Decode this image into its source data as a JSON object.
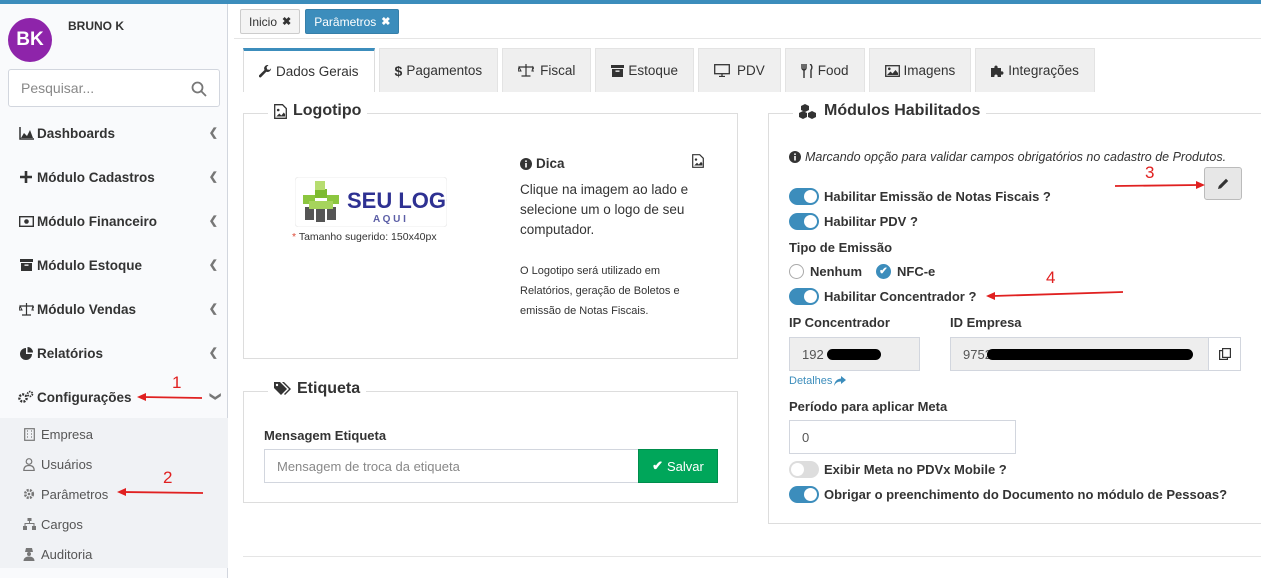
{
  "user": {
    "initials": "BK",
    "name": "BRUNO K"
  },
  "search": {
    "placeholder": "Pesquisar..."
  },
  "sidebar": {
    "items": [
      {
        "label": "Dashboards"
      },
      {
        "label": "Módulo Cadastros"
      },
      {
        "label": "Módulo Financeiro"
      },
      {
        "label": "Módulo Estoque"
      },
      {
        "label": "Módulo Vendas"
      },
      {
        "label": "Relatórios"
      },
      {
        "label": "Configurações"
      }
    ],
    "subitems": [
      {
        "label": "Empresa"
      },
      {
        "label": "Usuários"
      },
      {
        "label": "Parâmetros"
      },
      {
        "label": "Cargos"
      },
      {
        "label": "Auditoria"
      }
    ]
  },
  "breadcrumbs": [
    {
      "label": "Inicio"
    },
    {
      "label": "Parâmetros"
    }
  ],
  "tabs": [
    {
      "label": "Dados Gerais"
    },
    {
      "label": "Pagamentos"
    },
    {
      "label": "Fiscal"
    },
    {
      "label": "Estoque"
    },
    {
      "label": "PDV"
    },
    {
      "label": "Food"
    },
    {
      "label": "Imagens"
    },
    {
      "label": "Integrações"
    }
  ],
  "logotipo": {
    "title": "Logotipo",
    "logo_text_1": "SEU LOGO",
    "logo_text_2": "A Q U I",
    "size_star": "*",
    "size_hint": "Tamanho sugerido: 150x40px",
    "tip_title": "Dica",
    "tip_text": "Clique na imagem ao lado e selecione um o logo de seu computador.",
    "tip_note": "O Logotipo será utilizado em Relatórios, geração de Boletos e emissão de Notas Fiscais."
  },
  "etiqueta": {
    "title": "Etiqueta",
    "field_label": "Mensagem Etiqueta",
    "field_placeholder": "Mensagem de troca da etiqueta",
    "save_label": "Salvar"
  },
  "modulos": {
    "title": "Módulos Habilitados",
    "note": "Marcando opção para validar campos obrigatórios no cadastro de Produtos.",
    "toggle_nfe": "Habilitar Emissão de Notas Fiscais ?",
    "toggle_pdv": "Habilitar PDV ?",
    "emissao_label": "Tipo de Emissão",
    "radio_nenhum": "Nenhum",
    "radio_nfce": "NFC-e",
    "toggle_concentrador": "Habilitar Concentrador ?",
    "ip_label": "IP Concentrador",
    "ip_value": "192",
    "empresa_label": "ID Empresa",
    "empresa_value": "9752",
    "detalhes": "Detalhes",
    "periodo_label": "Período para aplicar Meta",
    "periodo_value": "0",
    "toggle_meta": "Exibir Meta no PDVx Mobile ?",
    "toggle_doc": "Obrigar o preenchimento do Documento no módulo de Pessoas?"
  },
  "annotations": {
    "a1": "1",
    "a2": "2",
    "a3": "3",
    "a4": "4"
  },
  "colors": {
    "primary": "#3c8dbc",
    "success": "#00a65a",
    "avatar": "#8e24aa",
    "annotation": "#e02020"
  }
}
